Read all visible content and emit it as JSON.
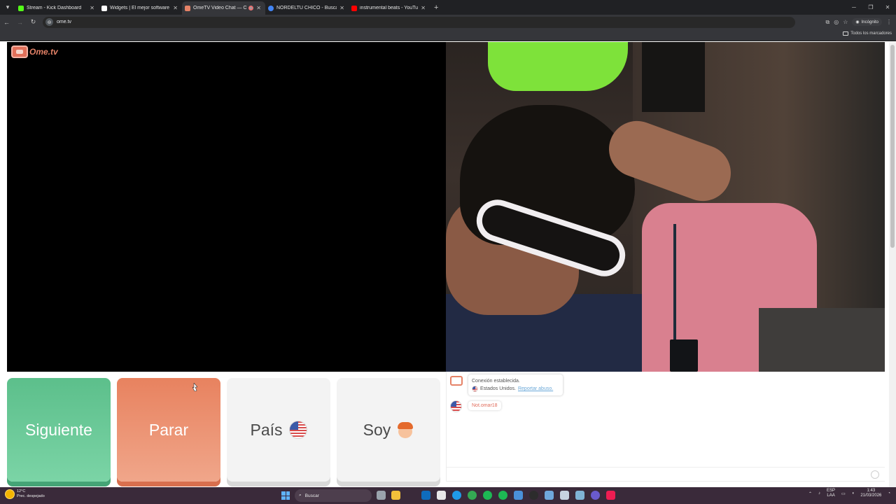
{
  "browser": {
    "tabs": [
      {
        "title": "Stream - Kick Dashboard",
        "favicon_color": "#53fc18"
      },
      {
        "title": "Widgets | El mejor software pa",
        "favicon_color": "#ffffff"
      },
      {
        "title": "OmeTV Video Chat — Ome",
        "favicon_color": "#e58267",
        "active": true
      },
      {
        "title": "NORDELTU CHICO - Buscar con",
        "favicon_color": "#4285f4"
      },
      {
        "title": "instrumental beats - YouTube",
        "favicon_color": "#ff0000"
      }
    ],
    "new_tab_icon": "+",
    "url": "ome.tv",
    "incognito_label": "Incógnito",
    "bookmarks_all_label": "Todos los marcadores"
  },
  "page": {
    "logo_text": "Ome.tv",
    "buttons": {
      "next": "Siguiente",
      "stop": "Parar",
      "country": "País",
      "gender": "Soy"
    },
    "chat": {
      "system_line1": "Conexión establecida.",
      "system_country": "Estados Unidos.",
      "report_link": "Reportar abuso.",
      "user_name": "Not.omar18"
    }
  },
  "taskbar": {
    "weather_temp": "12°C",
    "weather_desc": "Prec. despejado",
    "search_placeholder": "Buscar",
    "lang_line1": "ESP",
    "lang_line2": "LAA",
    "time": "1:43",
    "date": "21/03/2026"
  },
  "colors": {
    "next_button": "#5cbf8b",
    "stop_button": "#e8825f",
    "brand": "#e58267"
  }
}
